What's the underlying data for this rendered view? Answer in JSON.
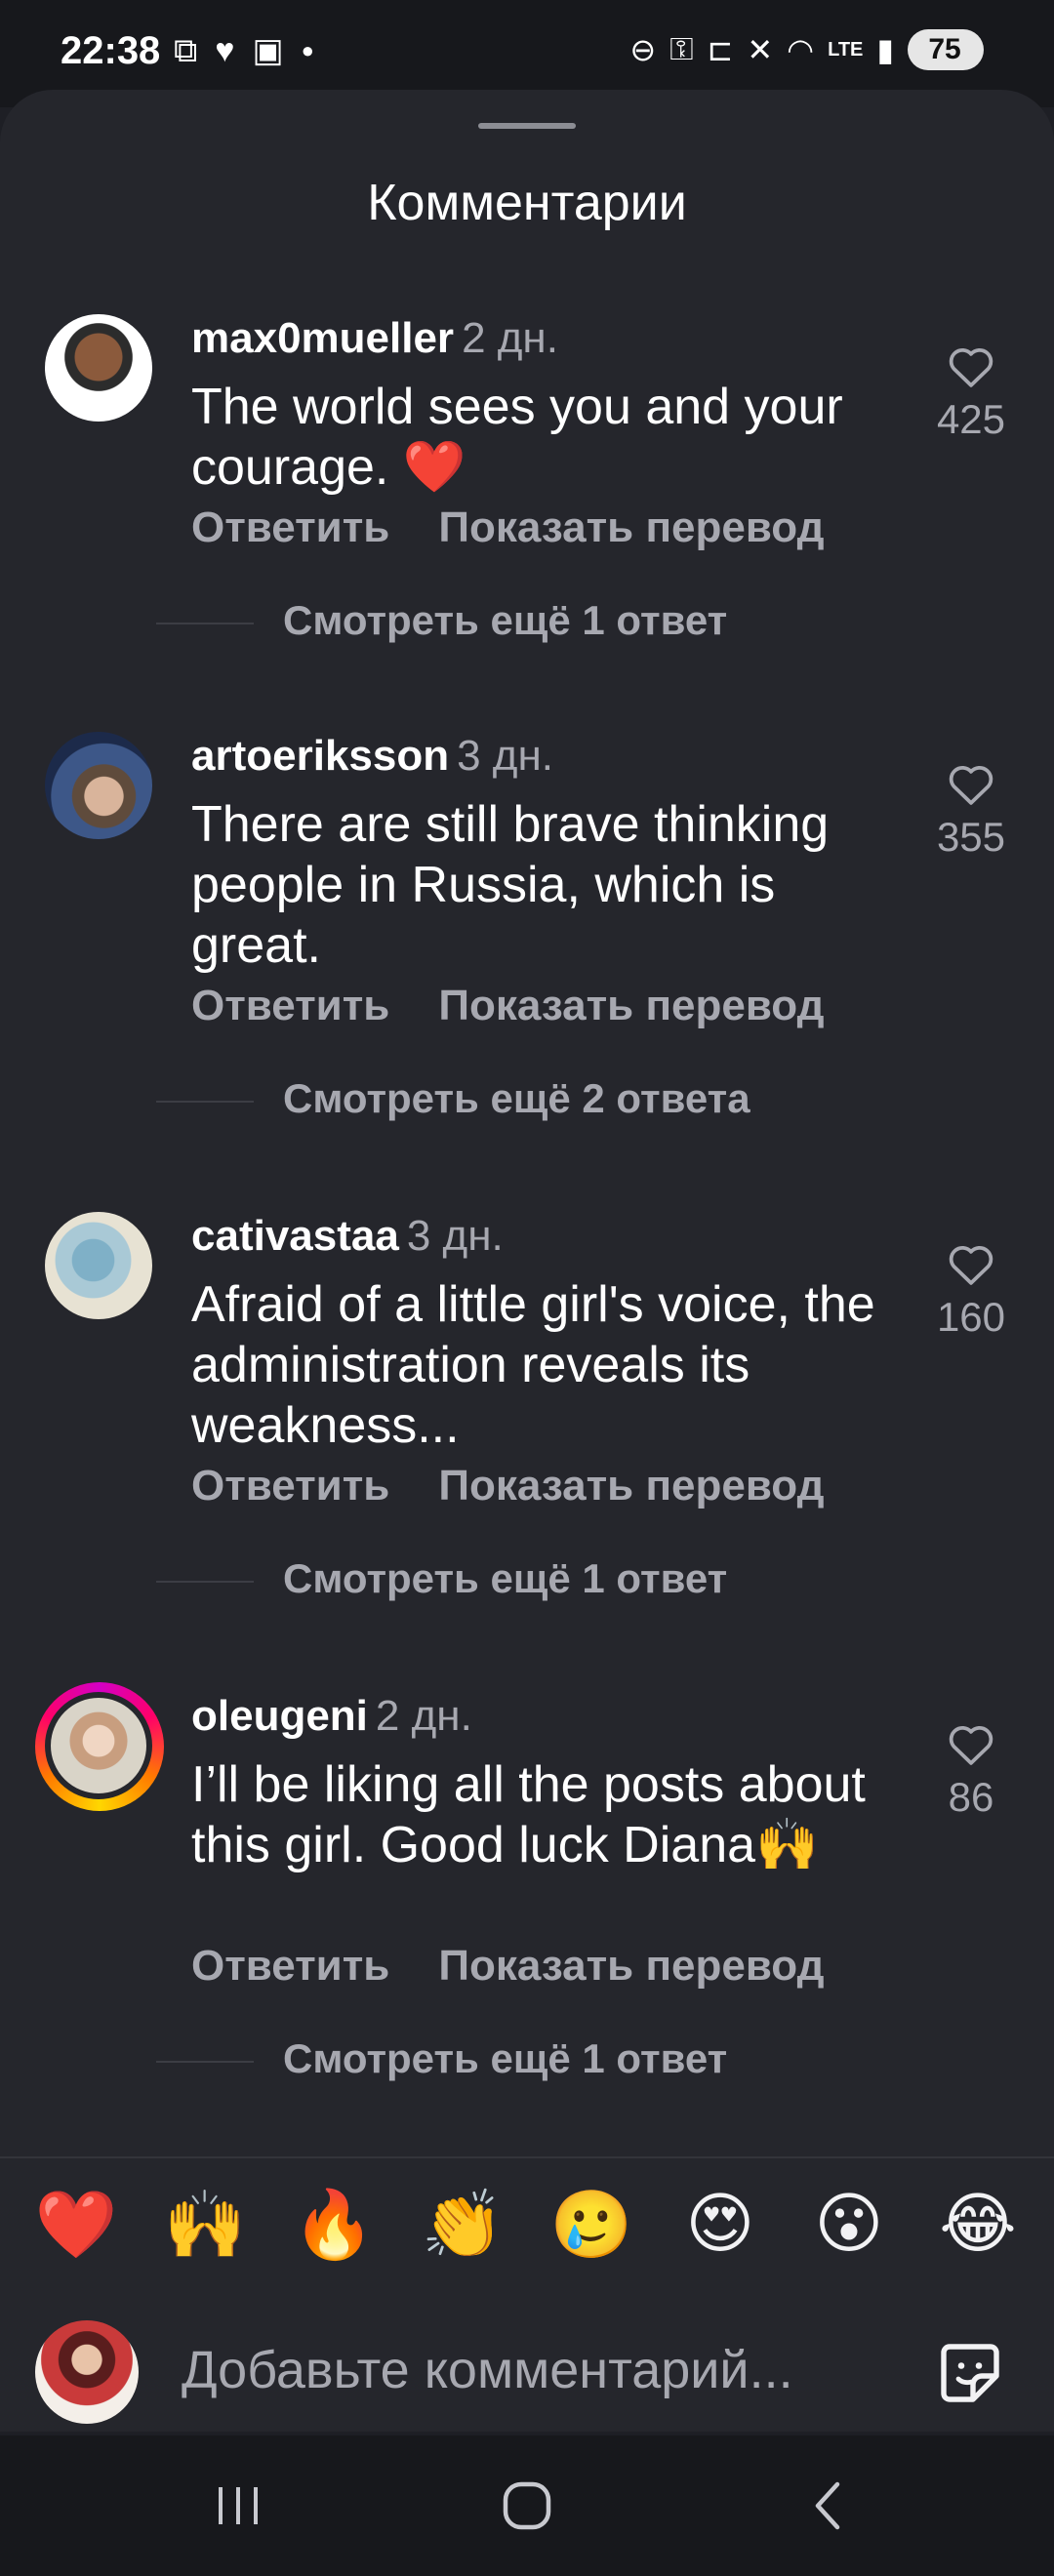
{
  "status_bar": {
    "time": "22:38",
    "battery": "75"
  },
  "sheet": {
    "title": "Комментарии"
  },
  "comments": [
    {
      "username": "max0mueller",
      "time": "2 дн.",
      "text": "The world sees you and your courage. ❤️",
      "likes": "425",
      "reply_label": "Ответить",
      "translate_label": "Показать перевод",
      "view_replies": "Смотреть ещё 1 ответ"
    },
    {
      "username": "artoeriksson",
      "time": "3 дн.",
      "text": "There are still brave thinking people in Russia, which is great.",
      "likes": "355",
      "reply_label": "Ответить",
      "translate_label": "Показать перевод",
      "view_replies": "Смотреть ещё 2 ответа"
    },
    {
      "username": "cativastaa",
      "time": "3 дн.",
      "text": "Afraid of a little girl's voice, the administration reveals its weakness...",
      "likes": "160",
      "reply_label": "Ответить",
      "translate_label": "Показать перевод",
      "view_replies": "Смотреть ещё 1 ответ"
    },
    {
      "username": "oleugeni",
      "time": "2 дн.",
      "text": "I’ll be liking all the posts about this girl. Good luck Diana🙌",
      "likes": "86",
      "reply_label": "Ответить",
      "translate_label": "Показать перевод",
      "view_replies": "Смотреть ещё 1 ответ"
    }
  ],
  "emoji_bar": [
    "❤️",
    "🙌",
    "🔥",
    "👏",
    "🥲",
    "😍",
    "😮",
    "😂"
  ],
  "composer": {
    "placeholder": "Добавьте комментарий..."
  },
  "colors": {
    "background": "#25262c",
    "secondary_text": "#a7a8b0",
    "story_ring": "#ff0069"
  }
}
